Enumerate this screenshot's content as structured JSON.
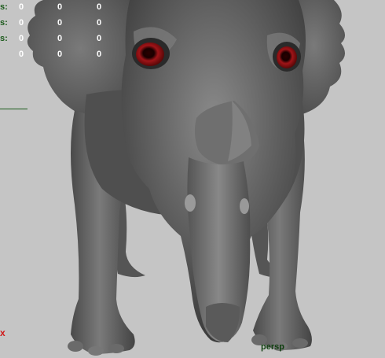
{
  "hud": {
    "rows": [
      {
        "label": "s:",
        "values": [
          "0",
          "0",
          "0"
        ]
      },
      {
        "label": "s:",
        "values": [
          "0",
          "0",
          "0"
        ]
      },
      {
        "label": "s:",
        "values": [
          "0",
          "0",
          "0"
        ]
      },
      {
        "label": "",
        "values": [
          "0",
          "0",
          "0"
        ]
      }
    ]
  },
  "axis": {
    "x_label": "x"
  },
  "camera": {
    "name": "persp"
  },
  "colors": {
    "background": "#c5c5c5",
    "hud_label": "#1a5a1a",
    "hud_value": "#ffffff",
    "axis_x": "#d01818",
    "camera_label": "#0f3f0f",
    "eye": "#8a0f12"
  }
}
